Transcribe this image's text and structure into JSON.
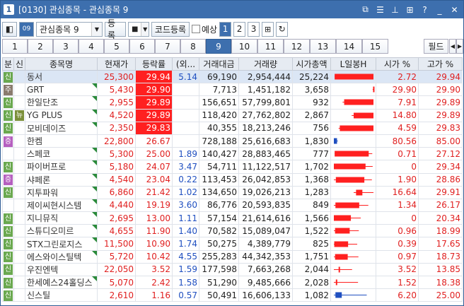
{
  "window": {
    "icon": "1",
    "title": "[0130] 관심종목 - 관심종목 9",
    "buttons": [
      "restore-icon",
      "list-icon",
      "pin-icon",
      "grid-icon",
      "help-icon",
      "minimize-icon",
      "close-icon"
    ]
  },
  "toolbar": {
    "group_value": "관심종목 9",
    "register_label": "등록",
    "code_register_label": "코드등록",
    "forecast_label": "예상",
    "pages": [
      "1",
      "2",
      "3"
    ],
    "active_page": "1"
  },
  "tabs": [
    "1",
    "2",
    "3",
    "4",
    "5",
    "6",
    "7",
    "8",
    "9",
    "10",
    "11",
    "12",
    "13",
    "14",
    "15"
  ],
  "active_tab": "9",
  "field_label": "필드",
  "columns": [
    "분",
    "신",
    "종목명",
    "현재가",
    "등락률",
    "(외...",
    "거래대금",
    "거래량",
    "시가총액",
    "L일봉H",
    "시가 %",
    "고가 %"
  ],
  "rows": [
    {
      "b1": "신",
      "b2": "",
      "name": "동서",
      "price": "25,300",
      "rate": "29.94",
      "foreign": "5.14",
      "amount": "69,190",
      "volume": "2,954,444",
      "mcap": "25,224",
      "open": "2.72",
      "high": "29.94",
      "limit": true,
      "tri": false,
      "lo": 0.02,
      "hi": 1.0,
      "o": 0.02,
      "c": 1.0,
      "up": true
    },
    {
      "b1": "주",
      "b2": "",
      "name": "GRT",
      "price": "5,430",
      "rate": "29.90",
      "foreign": "",
      "amount": "7,713",
      "volume": "1,451,182",
      "mcap": "3,658",
      "open": "29.90",
      "high": "29.90",
      "limit": true,
      "tri": true,
      "lo": 0.98,
      "hi": 1.0,
      "o": 0.99,
      "c": 1.0,
      "up": true
    },
    {
      "b1": "신",
      "b2": "",
      "name": "한일단조",
      "price": "2,955",
      "rate": "29.89",
      "foreign": "",
      "amount": "156,651",
      "volume": "57,799,801",
      "mcap": "932",
      "open": "7.91",
      "high": "29.89",
      "limit": true,
      "tri": true,
      "lo": 0.22,
      "hi": 1.0,
      "o": 0.26,
      "c": 1.0,
      "up": true
    },
    {
      "b1": "신",
      "b2": "뉴",
      "name": "YG PLUS",
      "price": "4,520",
      "rate": "29.89",
      "foreign": "",
      "amount": "118,420",
      "volume": "27,762,802",
      "mcap": "2,867",
      "open": "14.80",
      "high": "29.89",
      "limit": true,
      "tri": true,
      "lo": 0.45,
      "hi": 1.0,
      "o": 0.5,
      "c": 1.0,
      "up": true
    },
    {
      "b1": "신",
      "b2": "",
      "name": "모비데이즈",
      "price": "2,350",
      "rate": "29.83",
      "foreign": "",
      "amount": "40,355",
      "volume": "18,213,246",
      "mcap": "756",
      "open": "4.59",
      "high": "29.83",
      "limit": true,
      "tri": true,
      "lo": 0.12,
      "hi": 1.0,
      "o": 0.15,
      "c": 1.0,
      "up": true
    },
    {
      "b1": "증",
      "b2": "",
      "name": "한켐",
      "price": "22,800",
      "rate": "26.67",
      "foreign": "",
      "amount": "728,188",
      "volume": "25,616,683",
      "mcap": "1,830",
      "open": "80.56",
      "high": "85.00",
      "limit": false,
      "tri": false,
      "lo": 0.0,
      "hi": 0.1,
      "o": 0.0,
      "c": 0.08,
      "up": false
    },
    {
      "b1": "",
      "b2": "",
      "name": "스페코",
      "price": "5,300",
      "rate": "25.00",
      "foreign": "1.89",
      "amount": "140,427",
      "volume": "28,883,465",
      "mcap": "777",
      "open": "0.71",
      "high": "27.12",
      "limit": false,
      "tri": true,
      "lo": 0.02,
      "hi": 0.97,
      "o": 0.02,
      "c": 0.88,
      "up": true
    },
    {
      "b1": "신",
      "b2": "",
      "name": "파이버프로",
      "price": "5,180",
      "rate": "24.07",
      "foreign": "3.47",
      "amount": "54,711",
      "volume": "11,122,517",
      "mcap": "1,702",
      "open": "0",
      "high": "29.34",
      "limit": false,
      "tri": true,
      "lo": 0.0,
      "hi": 0.98,
      "o": 0.0,
      "c": 0.8,
      "up": true
    },
    {
      "b1": "증",
      "b2": "",
      "name": "샤페론",
      "price": "4,540",
      "rate": "23.04",
      "foreign": "0.22",
      "amount": "113,453",
      "volume": "26,042,853",
      "mcap": "1,368",
      "open": "1.90",
      "high": "28.86",
      "limit": false,
      "tri": true,
      "lo": 0.0,
      "hi": 0.96,
      "o": 0.05,
      "c": 0.77,
      "up": true
    },
    {
      "b1": "신",
      "b2": "",
      "name": "지투파워",
      "price": "6,860",
      "rate": "21.42",
      "foreign": "1.02",
      "amount": "134,650",
      "volume": "19,026,213",
      "mcap": "1,283",
      "open": "16.64",
      "high": "29.91",
      "limit": false,
      "tri": true,
      "lo": 0.5,
      "hi": 1.0,
      "o": 0.56,
      "c": 0.72,
      "up": true
    },
    {
      "b1": "",
      "b2": "",
      "name": "제이씨현시스템",
      "price": "4,440",
      "rate": "19.19",
      "foreign": "3.60",
      "amount": "86,776",
      "volume": "20,593,835",
      "mcap": "849",
      "open": "1.34",
      "high": "26.17",
      "limit": false,
      "tri": true,
      "lo": 0.0,
      "hi": 0.87,
      "o": 0.04,
      "c": 0.64,
      "up": true
    },
    {
      "b1": "신",
      "b2": "",
      "name": "지니뮤직",
      "price": "2,695",
      "rate": "13.00",
      "foreign": "1.11",
      "amount": "57,154",
      "volume": "21,614,616",
      "mcap": "1,566",
      "open": "0",
      "high": "20.34",
      "limit": false,
      "tri": true,
      "lo": 0.0,
      "hi": 0.68,
      "o": 0.0,
      "c": 0.43,
      "up": true
    },
    {
      "b1": "신",
      "b2": "",
      "name": "스튜디오미르",
      "price": "4,655",
      "rate": "11.90",
      "foreign": "1.40",
      "amount": "70,582",
      "volume": "15,089,047",
      "mcap": "1,522",
      "open": "0.96",
      "high": "18.99",
      "limit": false,
      "tri": true,
      "lo": 0.0,
      "hi": 0.63,
      "o": 0.03,
      "c": 0.4,
      "up": true
    },
    {
      "b1": "신",
      "b2": "",
      "name": "STX그린로지스",
      "price": "11,500",
      "rate": "10.90",
      "foreign": "1.74",
      "amount": "50,275",
      "volume": "4,389,779",
      "mcap": "825",
      "open": "0.39",
      "high": "17.65",
      "limit": false,
      "tri": true,
      "lo": 0.0,
      "hi": 0.59,
      "o": 0.01,
      "c": 0.36,
      "up": true
    },
    {
      "b1": "신",
      "b2": "",
      "name": "에스와이스틸텍",
      "price": "5,720",
      "rate": "10.42",
      "foreign": "4.55",
      "amount": "255,283",
      "volume": "44,342,353",
      "mcap": "1,751",
      "open": "0.97",
      "high": "18.73",
      "limit": false,
      "tri": true,
      "lo": 0.0,
      "hi": 0.62,
      "o": 0.03,
      "c": 0.35,
      "up": true
    },
    {
      "b1": "신",
      "b2": "",
      "name": "우진엔텍",
      "price": "22,050",
      "rate": "3.52",
      "foreign": "1.59",
      "amount": "177,598",
      "volume": "7,663,268",
      "mcap": "2,044",
      "open": "3.52",
      "high": "13.85",
      "limit": false,
      "tri": false,
      "lo": 0.0,
      "hi": 0.46,
      "o": 0.12,
      "c": 0.12,
      "up": true
    },
    {
      "b1": "신",
      "b2": "",
      "name": "한세예스24홀딩스",
      "price": "5,070",
      "rate": "2.42",
      "foreign": "1.58",
      "amount": "51,290",
      "volume": "9,485,666",
      "mcap": "2,028",
      "open": "1.52",
      "high": "18.38",
      "limit": false,
      "tri": true,
      "lo": 0.0,
      "hi": 0.61,
      "o": 0.05,
      "c": 0.08,
      "up": true
    },
    {
      "b1": "신",
      "b2": "",
      "name": "신스틸",
      "price": "2,610",
      "rate": "1.16",
      "foreign": "0.57",
      "amount": "50,491",
      "volume": "16,606,133",
      "mcap": "1,082",
      "open": "6.20",
      "high": "25.00",
      "limit": false,
      "tri": false,
      "lo": 0.0,
      "hi": 0.83,
      "o": 0.2,
      "c": 0.04,
      "up": false
    }
  ],
  "colors": {
    "up": "#ff2020",
    "down": "#1f4fc0",
    "title": "#3d6fae"
  }
}
